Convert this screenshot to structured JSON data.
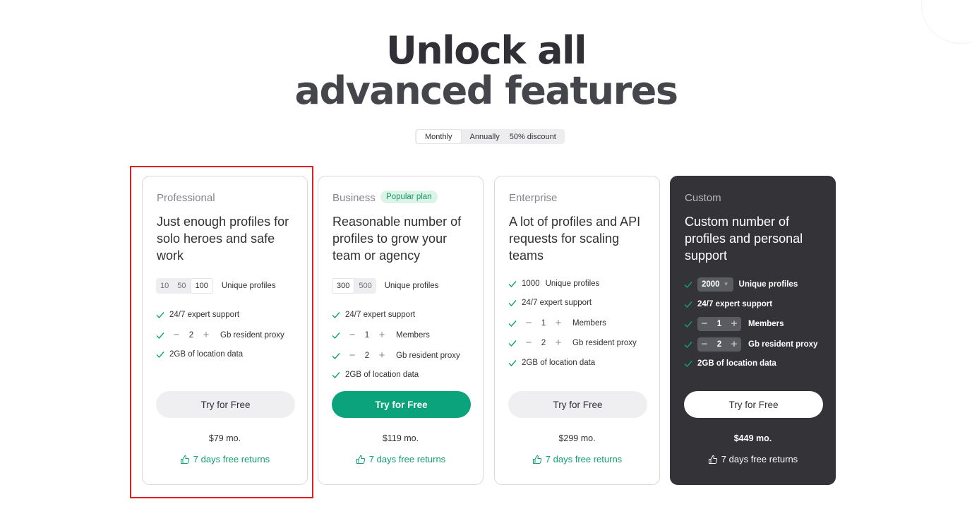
{
  "hero": {
    "line1": "Unlock all",
    "line2": "advanced features"
  },
  "billing": {
    "monthly": "Monthly",
    "annually": "Annually",
    "discount": "50% discount"
  },
  "plans": [
    {
      "name": "Professional",
      "description": "Just enough profiles for solo heroes and safe work",
      "profile_options": [
        "10",
        "50",
        "100"
      ],
      "profiles_label": "Unique profiles",
      "support": "24/7 expert support",
      "proxy_value": "2",
      "proxy_label": "Gb resident proxy",
      "location": "2GB of location data",
      "cta": "Try for Free",
      "price": "$79 mo.",
      "returns": "7 days free returns"
    },
    {
      "name": "Business",
      "badge": "Popular plan",
      "description": "Reasonable number of profiles to grow your team or agency",
      "profile_options": [
        "300",
        "500"
      ],
      "profiles_label": "Unique profiles",
      "support": "24/7 expert support",
      "members_value": "1",
      "members_label": "Members",
      "proxy_value": "2",
      "proxy_label": "Gb resident proxy",
      "location": "2GB of location data",
      "cta": "Try for Free",
      "price": "$119 mo.",
      "returns": "7 days free returns"
    },
    {
      "name": "Enterprise",
      "description": "A lot of profiles and API requests for scaling teams",
      "profiles_value": "1000",
      "profiles_label": "Unique profiles",
      "support": "24/7 expert support",
      "members_value": "1",
      "members_label": "Members",
      "proxy_value": "2",
      "proxy_label": "Gb resident proxy",
      "location": "2GB of location data",
      "cta": "Try for Free",
      "price": "$299 mo.",
      "returns": "7 days free returns"
    },
    {
      "name": "Custom",
      "description": "Custom number of profiles and personal support",
      "profiles_value": "2000",
      "profiles_label": "Unique profiles",
      "support": "24/7 expert support",
      "members_value": "1",
      "members_label": "Members",
      "proxy_value": "2",
      "proxy_label": "Gb resident proxy",
      "location": "2GB of location data",
      "cta": "Try for Free",
      "price": "$449 mo.",
      "returns": "7 days free returns"
    }
  ],
  "colors": {
    "accent": "#0aa37c",
    "dark_card": "#333338",
    "highlight": "#e0201e"
  },
  "icons": {
    "check": "check-icon",
    "thumbs_up": "thumbs-up-icon",
    "minus": "minus-icon",
    "plus": "plus-icon"
  }
}
